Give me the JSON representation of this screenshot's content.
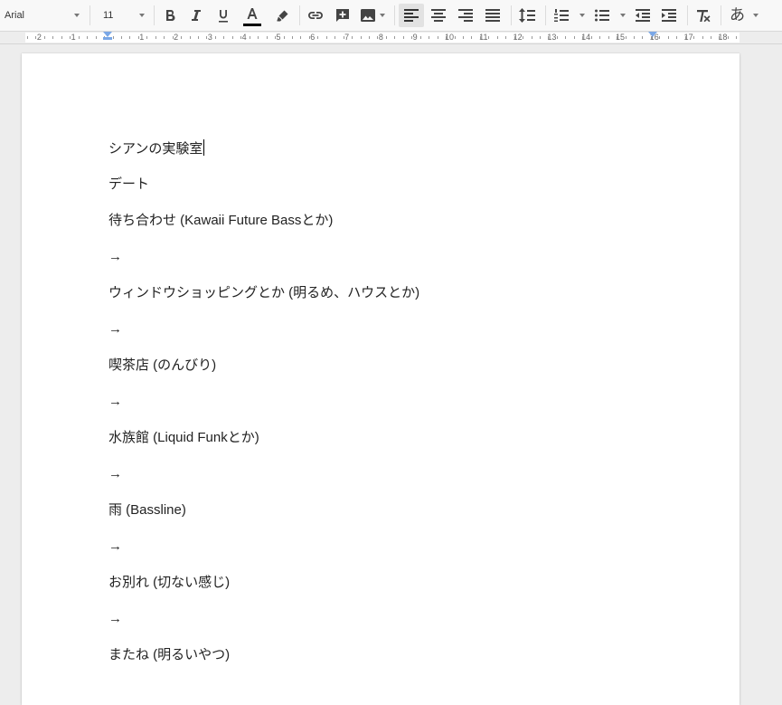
{
  "toolbar": {
    "font_family": "Arial",
    "font_size": "11",
    "input_tools_label": "あ",
    "icons": [
      "bold-icon",
      "italic-icon",
      "underline-icon",
      "text-color-icon",
      "highlight-icon",
      "link-icon",
      "insert-comment-icon",
      "insert-image-icon",
      "align-left-icon",
      "align-center-icon",
      "align-right-icon",
      "align-justify-icon",
      "line-spacing-icon",
      "numbered-list-icon",
      "bulleted-list-icon",
      "decrease-indent-icon",
      "increase-indent-icon",
      "clear-formatting-icon"
    ],
    "text_color": "#000000",
    "active_alignment": "left"
  },
  "ruler": {
    "numbers": [
      "2",
      "1",
      "1",
      "2",
      "3",
      "4",
      "5",
      "6",
      "7",
      "8",
      "9",
      "10",
      "11",
      "12",
      "13",
      "14",
      "15",
      "16",
      "17",
      "18"
    ]
  },
  "document": {
    "lines": [
      "シアンの実験室",
      "デート",
      "待ち合わせ (Kawaii Future Bassとか)",
      "→",
      "ウィンドウショッピングとか (明るめ、ハウスとか)",
      "→",
      "喫茶店 (のんびり)",
      "→",
      "水族館 (Liquid Funkとか)",
      "→",
      "雨 (Bassline)",
      "→",
      "お別れ (切ない感じ)",
      "→",
      "またね (明るいやつ)"
    ]
  }
}
